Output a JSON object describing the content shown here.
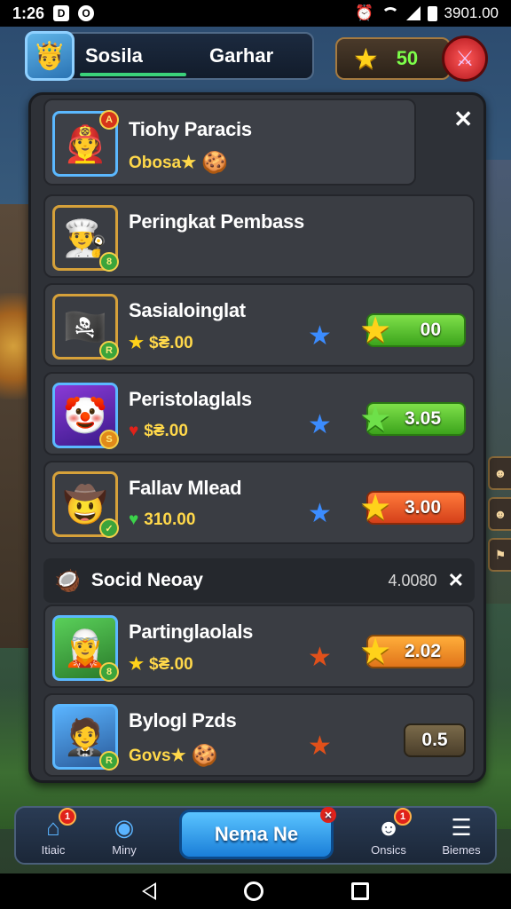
{
  "status_bar": {
    "time": "1:26",
    "left_icons": [
      "D",
      "O"
    ],
    "right_text": "3901.00"
  },
  "header": {
    "player_name": "Sosila",
    "guild_name": "Garhar",
    "currency_value": "50"
  },
  "panel": {
    "top_card": {
      "title": "Tiohy Paracis",
      "subtitle": "Obosa★"
    },
    "cards": [
      {
        "title": "Peringkat Pembass",
        "subtitle": "",
        "reward": ""
      },
      {
        "title": "Sasialoinglat",
        "subtitle": "$₴.00",
        "reward": "00",
        "mid_star_color": "#3b8cff",
        "reward_star_color": "#ffd21a",
        "reward_style": "green"
      },
      {
        "title": "Peristolaglals",
        "subtitle": "$₴.00",
        "reward": "3.05",
        "mid_star_color": "#3b8cff",
        "reward_star_color": "#6ee04a",
        "reward_style": "green"
      },
      {
        "title": "Fallav Mlead",
        "subtitle": "310.00",
        "reward": "3.00",
        "mid_star_color": "#3b8cff",
        "reward_star_color": "#ffd21a",
        "reward_style": "orange"
      }
    ],
    "section": {
      "title": "Socid Neoay",
      "value": "4.0080"
    },
    "section_cards": [
      {
        "title": "Partinglaolals",
        "subtitle": "$₴.00",
        "reward": "2.02",
        "mid_star_color": "#e0501a",
        "reward_star_color": "#ffd21a",
        "reward_style": "amber"
      },
      {
        "title": "Bylogl Pzds",
        "subtitle": "Govs★",
        "reward": "0.5",
        "mid_star_color": "#e0501a",
        "reward_style": "dark"
      }
    ]
  },
  "bottom_nav": {
    "items": [
      {
        "label": "Itiaic",
        "icon": "home-icon",
        "badge": "1"
      },
      {
        "label": "Miny",
        "icon": "globe-icon",
        "badge": ""
      },
      {
        "label": "Onsics",
        "icon": "character-icon",
        "badge": "1"
      },
      {
        "label": "Biemes",
        "icon": "chest-icon",
        "badge": ""
      }
    ],
    "center_button": "Nema Ne"
  },
  "colors": {
    "accent_green": "#7dff4a",
    "gold": "#ffd21a",
    "panel_bg": "#2e3137"
  }
}
